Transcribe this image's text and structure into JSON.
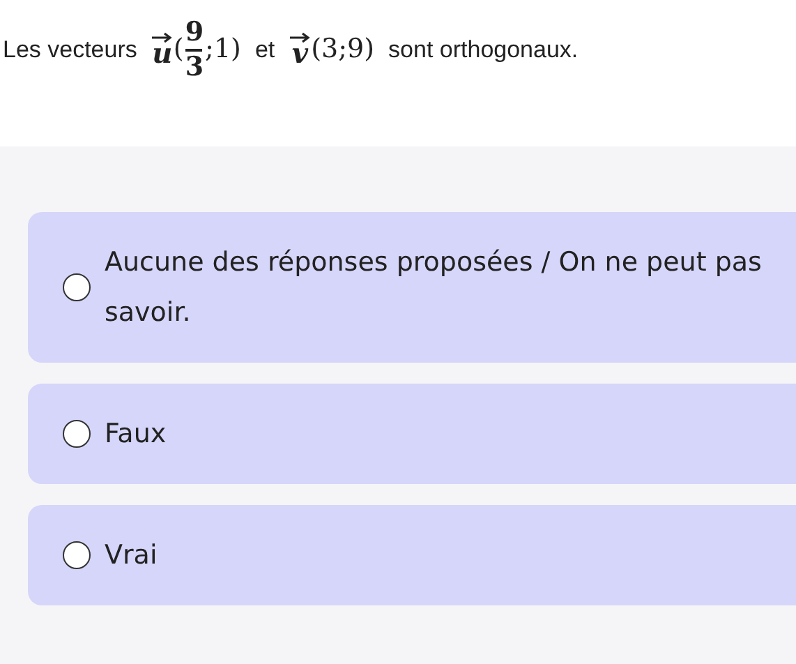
{
  "statement": {
    "prefix": "Les vecteurs",
    "vector_1": {
      "letter": "u",
      "open": "(",
      "numerator": "9",
      "denominator": "3",
      "rest": ";1)"
    },
    "middle": "et",
    "vector_2": {
      "letter": "v",
      "coordinates": "(3;9)"
    },
    "suffix": "sont orthogonaux."
  },
  "options": [
    {
      "label": "Aucune des réponses proposées / On ne peut pas savoir.",
      "selected": false
    },
    {
      "label": "Faux",
      "selected": false
    },
    {
      "label": "Vrai",
      "selected": false
    }
  ]
}
